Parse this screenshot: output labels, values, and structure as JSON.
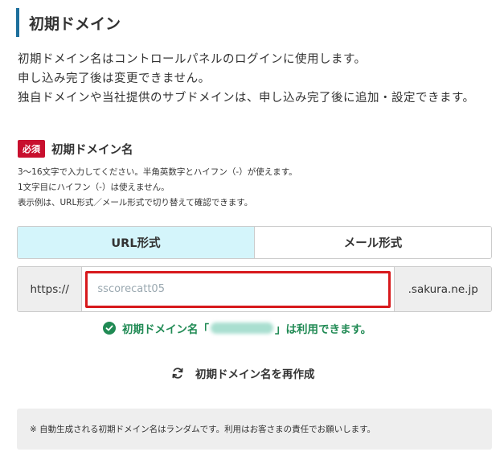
{
  "section": {
    "title": "初期ドメイン"
  },
  "intro": {
    "lines": [
      "初期ドメイン名はコントロールパネルのログインに使用します。",
      "申し込み完了後は変更できません。",
      "独自ドメインや当社提供のサブドメインは、申し込み完了後に追加・設定できます。"
    ]
  },
  "field": {
    "required_badge": "必須",
    "label": "初期ドメイン名",
    "help": [
      "3〜16文字で入力してください。半角英数字とハイフン（-）が使えます。",
      "1文字目にハイフン（-）は使えません。",
      "表示例は、URL形式／メール形式で切り替えて確認できます。"
    ]
  },
  "tabs": [
    {
      "label": "URL形式",
      "active": true
    },
    {
      "label": "メール形式",
      "active": false
    }
  ],
  "domain": {
    "prefix": "https://",
    "value": "sscorecatt05",
    "suffix": ".sakura.ne.jp"
  },
  "status": {
    "prefix": "初期ドメイン名「",
    "suffix": "」は利用できます。",
    "color": "#208a54"
  },
  "regenerate": {
    "label": "初期ドメイン名を再作成"
  },
  "notice": {
    "text": "※ 自動生成される初期ドメイン名はランダムです。利用はお客さまの責任でお願いします。"
  },
  "colors": {
    "accent_bar": "#1d6f9c",
    "required": "#c8102e",
    "active_tab": "#d4f5fb",
    "input_border": "#d7191c"
  }
}
